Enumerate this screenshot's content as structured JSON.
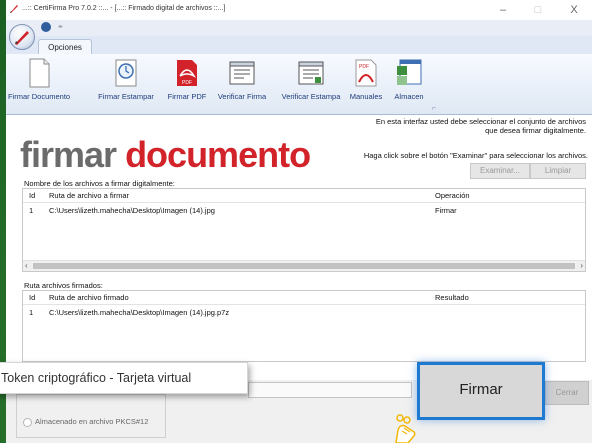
{
  "window": {
    "title": "...:: CertiFirma Pro 7.0.2 ::... - [...:: Firmado digital de archivos ::...]",
    "controls": [
      "–",
      "□",
      "X"
    ]
  },
  "ribbon": {
    "tab": "Opciones",
    "buttons": [
      {
        "label": "Firmar Documento",
        "icon": "document-icon"
      },
      {
        "label": "Firmar Estampar",
        "icon": "clock-stamp-icon"
      },
      {
        "label": "Firmar PDF",
        "icon": "pdf-icon"
      },
      {
        "label": "Verificar Firma",
        "icon": "verify-window-icon"
      },
      {
        "label": "Verificar Estampa",
        "icon": "verify-stamp-icon"
      },
      {
        "label": "Manuales",
        "icon": "pdf-manual-icon"
      },
      {
        "label": "Almacen",
        "icon": "certificate-store-icon"
      }
    ]
  },
  "header": {
    "logo_word1": "firmar",
    "logo_word2": "documento",
    "info_line1": "En esta interfaz usted debe seleccionar el conjunto de archivos",
    "info_line2": "que  desea firmar digitalmente.",
    "info_line3": "Haga click sobre el botón \"Examinar\" para seleccionar los archivos.",
    "examinar": "Examinar...",
    "limpiar": "Limpiar"
  },
  "to_sign": {
    "label": "Nombre de los archivos a firmar digitalmente:",
    "columns": [
      "Id",
      "Ruta de archivo a firmar",
      "Operación"
    ],
    "rows": [
      {
        "id": "1",
        "path": "C:\\Users\\lizeth.mahecha\\Desktop\\Imagen (14).jpg",
        "op": "Firmar"
      }
    ]
  },
  "signed": {
    "label": "Ruta archivos firmados:",
    "columns": [
      "Id",
      "Ruta de archivo firmado",
      "Resultado"
    ],
    "rows": [
      {
        "id": "1",
        "path": "C:\\Users\\lizeth.mahecha\\Desktop\\Imagen (14).jpg.p7z",
        "result": ""
      }
    ]
  },
  "token": {
    "popup": "Token criptográfico - Tarjeta virtual",
    "radio": "Almacenado en archivo PKCS#12"
  },
  "actions": {
    "firmar": "Firmar",
    "cerrar": "Cerrar"
  },
  "colors": {
    "brand_red": "#d2232a",
    "logo_gray": "#6b6b6b",
    "focus_blue": "#1e7ad1",
    "background_green": "#2e7d32"
  }
}
